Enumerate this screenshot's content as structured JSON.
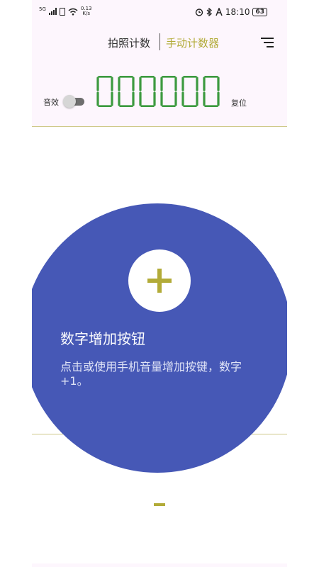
{
  "status_bar": {
    "network": "5G",
    "speed_value": "0.13",
    "speed_unit": "K/s",
    "time": "18:10",
    "battery": "63",
    "icons": [
      "alarm-icon",
      "bluetooth-icon",
      "nfc-icon"
    ]
  },
  "header": {
    "tab_photo": "拍照计数",
    "tab_manual": "手动计数器",
    "menu_icon": "menu-icon"
  },
  "counter": {
    "sound_label": "音效",
    "sound_enabled": false,
    "digits": [
      "0",
      "0",
      "0",
      "0",
      "0",
      "0"
    ],
    "reset_label": "复位"
  },
  "tooltip": {
    "title": "数字增加按钮",
    "description": "点击或使用手机音量增加按键，数字 +1。"
  },
  "buttons": {
    "plus_icon": "plus-icon",
    "minus_icon": "minus-icon"
  },
  "colors": {
    "accent": "#b2ab38",
    "digit": "#3c9a3f",
    "overlay": "#4658b6",
    "header_bg": "#fdf6fd"
  }
}
